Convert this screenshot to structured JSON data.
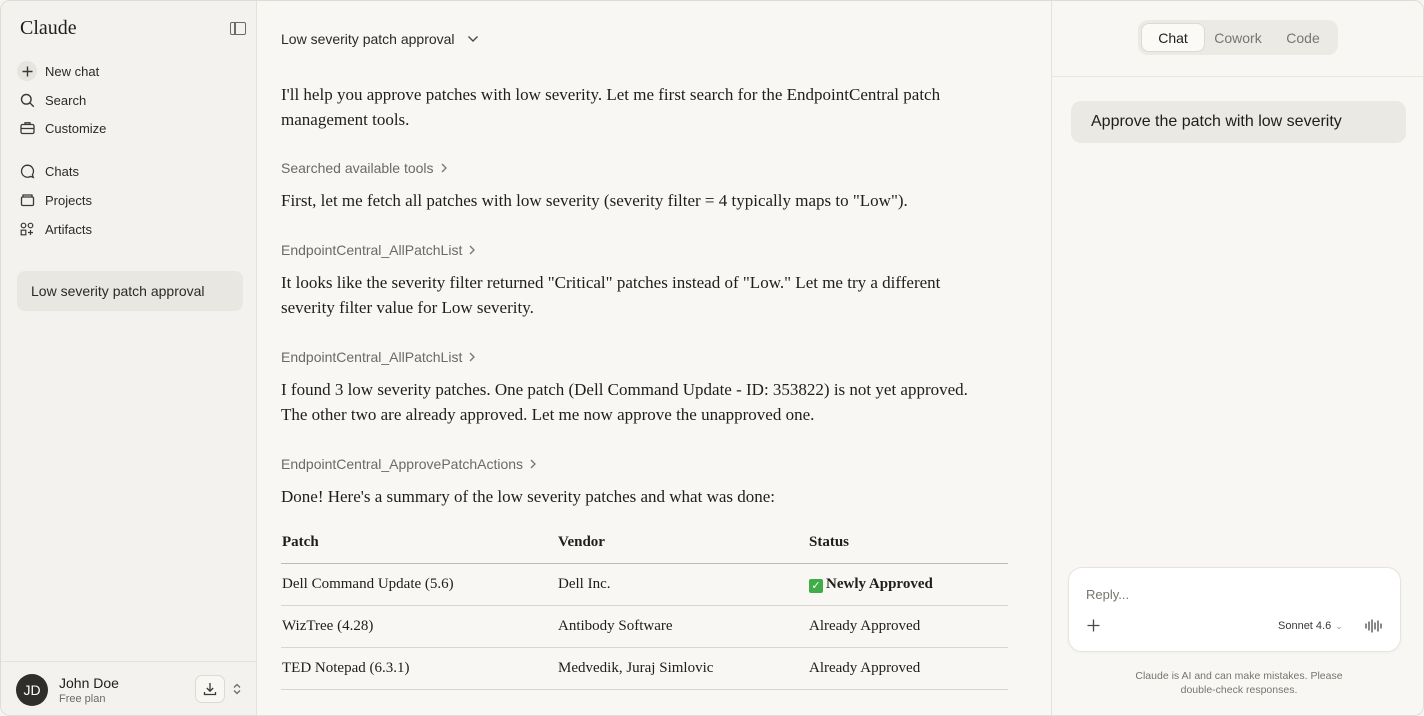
{
  "sidebar": {
    "brand": "Claude",
    "nav": [
      {
        "label": "New chat",
        "icon": "plus-icon"
      },
      {
        "label": "Search",
        "icon": "search-icon"
      },
      {
        "label": "Customize",
        "icon": "briefcase-icon"
      },
      {
        "label": "Chats",
        "icon": "chat-bubble-icon"
      },
      {
        "label": "Projects",
        "icon": "folder-icon"
      },
      {
        "label": "Artifacts",
        "icon": "grid-icon"
      }
    ],
    "recent": [
      "Low severity patch approval"
    ],
    "user": {
      "initials": "JD",
      "name": "John Doe",
      "plan": "Free plan"
    }
  },
  "main": {
    "conversation_title": "Low severity patch approval",
    "messages": [
      "I'll help you approve patches with low severity. Let me first search for the EndpointCentral patch management tools.",
      "First, let me fetch all patches with low severity (severity filter = 4 typically maps to \"Low\").",
      "It looks like the severity filter returned \"Critical\" patches instead of \"Low.\" Let me try a different severity filter value for Low severity.",
      "I found 3 low severity patches. One patch (Dell Command Update - ID: 353822) is not yet approved. The other two are already approved. Let me now approve the unapproved one.",
      "Done! Here's a summary of the low severity patches and what was done:"
    ],
    "tool_calls": [
      "Searched available tools",
      "EndpointCentral_AllPatchList",
      "EndpointCentral_AllPatchList",
      "EndpointCentral_ApprovePatchActions"
    ],
    "table": {
      "headers": [
        "Patch",
        "Vendor",
        "Status"
      ],
      "rows": [
        {
          "patch": "Dell Command Update (5.6)",
          "vendor": "Dell Inc.",
          "status": "Newly Approved"
        },
        {
          "patch": "WizTree (4.28)",
          "vendor": "Antibody Software",
          "status": "Already Approved"
        },
        {
          "patch": "TED Notepad (6.3.1)",
          "vendor": "Medvedik, Juraj Simlovic",
          "status": "Already Approved"
        }
      ]
    }
  },
  "right_panel": {
    "tabs": [
      "Chat",
      "Cowork",
      "Code"
    ],
    "active_tab": "Chat",
    "user_message": "Approve the patch with low severity",
    "composer_placeholder": "Reply...",
    "model": "Sonnet 4.6",
    "disclaimer_line1": "Claude is AI and can make mistakes. Please",
    "disclaimer_line2": "double-check responses."
  },
  "colors": {
    "background": "#f8f7f3",
    "sidebar": "#f3f2ee",
    "approved_check": "#3fae49"
  }
}
